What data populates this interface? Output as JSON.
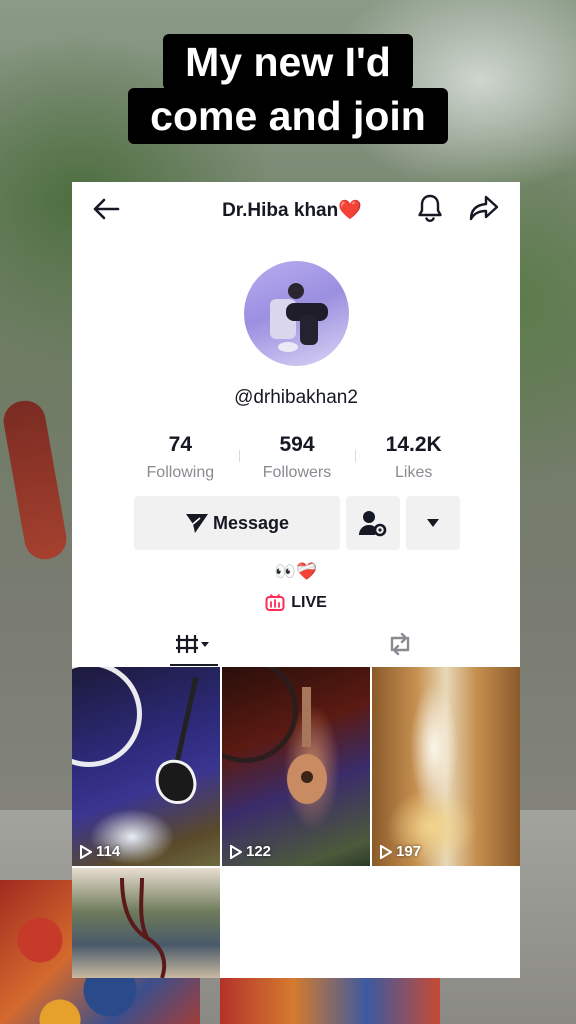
{
  "caption": {
    "line1": "My new I'd",
    "line2": "come and join"
  },
  "header": {
    "title": "Dr.Hiba khan",
    "title_emoji": "❤️"
  },
  "profile": {
    "username": "@drhibakhan2",
    "stats": [
      {
        "value": "74",
        "label": "Following"
      },
      {
        "value": "594",
        "label": "Followers"
      },
      {
        "value": "14.2K",
        "label": "Likes"
      }
    ],
    "bio": "👀❤️‍🩹",
    "live_label": "LIVE"
  },
  "actions": {
    "message_label": "Message"
  },
  "videos": [
    {
      "views": "114"
    },
    {
      "views": "122"
    },
    {
      "views": "197"
    },
    {
      "views": ""
    }
  ],
  "colors": {
    "accent": "#fe2c55",
    "text": "#161823",
    "muted": "#8a8b91"
  }
}
